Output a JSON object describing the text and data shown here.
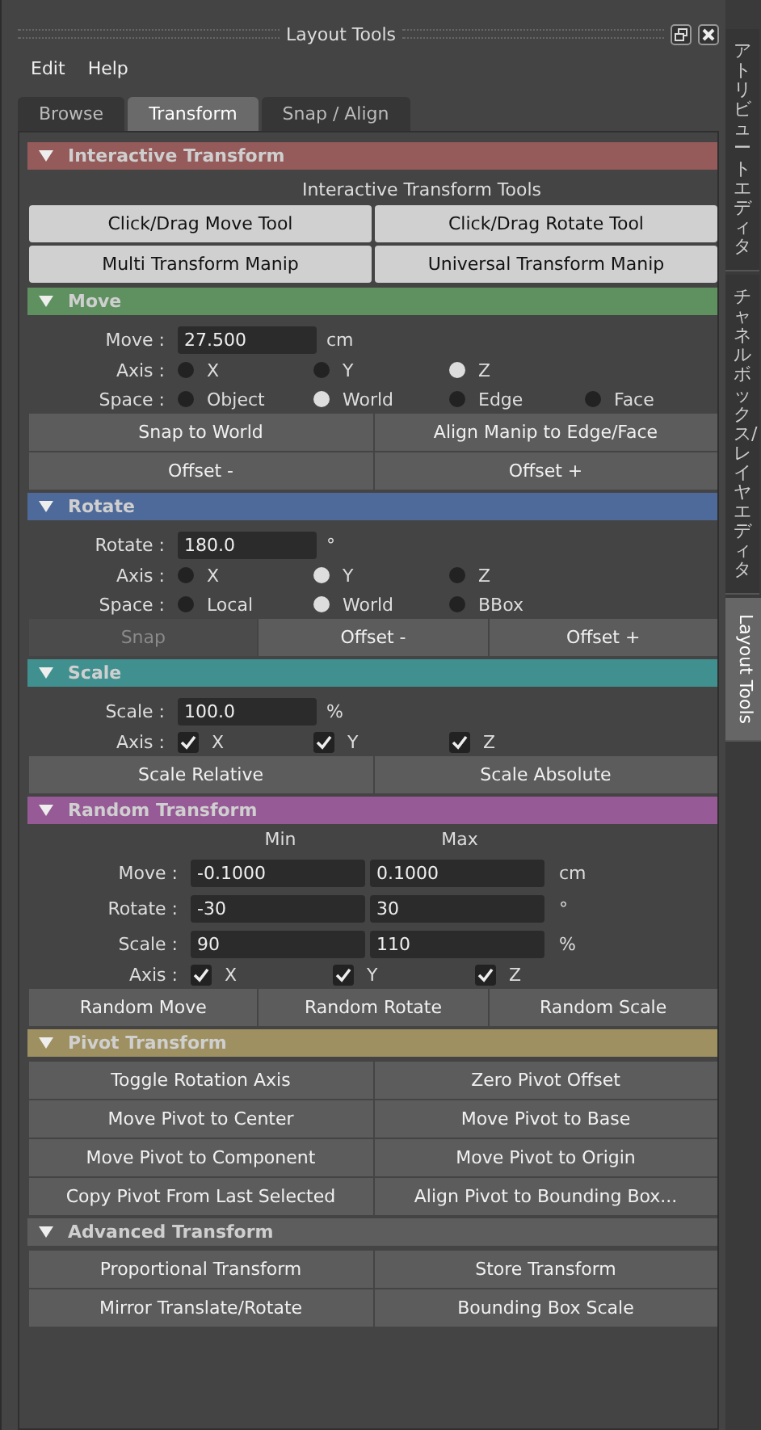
{
  "window": {
    "title": "Layout Tools"
  },
  "menu": [
    "Edit",
    "Help"
  ],
  "tabs": [
    {
      "label": "Browse",
      "selected": false
    },
    {
      "label": "Transform",
      "selected": true
    },
    {
      "label": "Snap / Align",
      "selected": false
    }
  ],
  "sections": [
    {
      "title": "Interactive Transform",
      "color": "#955a5a",
      "expanded": true,
      "rows": [
        {
          "kind": "caption",
          "text": "Interactive Transform Tools"
        },
        {
          "kind": "light_buttons",
          "buttons": [
            {
              "label": "Click/Drag Move Tool",
              "disabled": false
            },
            {
              "label": "Click/Drag Rotate Tool",
              "disabled": false
            }
          ]
        },
        {
          "kind": "light_buttons",
          "buttons": [
            {
              "label": "Multi Transform Manip",
              "disabled": false
            },
            {
              "label": "Universal Transform Manip",
              "disabled": false
            }
          ]
        }
      ]
    },
    {
      "title": "Move",
      "color": "#5f9160",
      "expanded": true,
      "rows": [
        {
          "kind": "field",
          "label": "Move :",
          "value": "27.500",
          "unit": "cm"
        },
        {
          "kind": "radio",
          "label": "Axis :",
          "options": [
            {
              "label": "X",
              "selected": false
            },
            {
              "label": "Y",
              "selected": false
            },
            {
              "label": "Z",
              "selected": true
            }
          ]
        },
        {
          "kind": "radio",
          "label": "Space :",
          "options": [
            {
              "label": "Object",
              "selected": false
            },
            {
              "label": "World",
              "selected": true
            },
            {
              "label": "Edge",
              "selected": false
            },
            {
              "label": "Face",
              "selected": false
            }
          ]
        },
        {
          "kind": "buttons",
          "buttons": [
            {
              "label": "Snap to World",
              "disabled": false
            },
            {
              "label": "Align Manip to Edge/Face",
              "disabled": false
            }
          ]
        },
        {
          "kind": "buttons",
          "buttons": [
            {
              "label": "Offset -",
              "disabled": false
            },
            {
              "label": "Offset +",
              "disabled": false
            }
          ]
        }
      ]
    },
    {
      "title": "Rotate",
      "color": "#4e6a9a",
      "expanded": true,
      "rows": [
        {
          "kind": "field",
          "label": "Rotate :",
          "value": "180.0",
          "unit": "°"
        },
        {
          "kind": "radio",
          "label": "Axis :",
          "options": [
            {
              "label": "X",
              "selected": false
            },
            {
              "label": "Y",
              "selected": true
            },
            {
              "label": "Z",
              "selected": false
            }
          ]
        },
        {
          "kind": "radio",
          "label": "Space :",
          "options": [
            {
              "label": "Local",
              "selected": false
            },
            {
              "label": "World",
              "selected": true
            },
            {
              "label": "BBox",
              "selected": false
            }
          ]
        },
        {
          "kind": "buttons",
          "buttons": [
            {
              "label": "Snap",
              "disabled": true
            },
            {
              "label": "Offset -",
              "disabled": false
            },
            {
              "label": "Offset +",
              "disabled": false
            }
          ]
        }
      ]
    },
    {
      "title": "Scale",
      "color": "#419090",
      "expanded": true,
      "rows": [
        {
          "kind": "field",
          "label": "Scale :",
          "value": "100.0",
          "unit": "%"
        },
        {
          "kind": "check",
          "label": "Axis :",
          "options": [
            {
              "label": "X",
              "checked": true
            },
            {
              "label": "Y",
              "checked": true
            },
            {
              "label": "Z",
              "checked": true
            }
          ]
        },
        {
          "kind": "buttons",
          "buttons": [
            {
              "label": "Scale Relative",
              "disabled": false
            },
            {
              "label": "Scale Absolute",
              "disabled": false
            }
          ]
        }
      ]
    },
    {
      "title": "Random Transform",
      "color": "#965a96",
      "expanded": true,
      "rows": [
        {
          "kind": "header",
          "columns": [
            "Min",
            "Max"
          ]
        },
        {
          "kind": "range",
          "label": "Move :",
          "min": "-0.1000",
          "max": "0.1000",
          "unit": "cm"
        },
        {
          "kind": "range",
          "label": "Rotate :",
          "min": "-30",
          "max": "30",
          "unit": "°"
        },
        {
          "kind": "range",
          "label": "Scale :",
          "min": "90",
          "max": "110",
          "unit": "%"
        },
        {
          "kind": "check",
          "label": "Axis :",
          "options": [
            {
              "label": "X",
              "checked": true
            },
            {
              "label": "Y",
              "checked": true
            },
            {
              "label": "Z",
              "checked": true
            }
          ]
        },
        {
          "kind": "buttons",
          "buttons": [
            {
              "label": "Random Move",
              "disabled": false
            },
            {
              "label": "Random Rotate",
              "disabled": false
            },
            {
              "label": "Random Scale",
              "disabled": false
            }
          ]
        }
      ]
    },
    {
      "title": "Pivot Transform",
      "color": "#9e9060",
      "expanded": true,
      "rows": [
        {
          "kind": "buttons",
          "buttons": [
            {
              "label": "Toggle Rotation Axis",
              "disabled": false
            },
            {
              "label": "Zero Pivot Offset",
              "disabled": false
            }
          ]
        },
        {
          "kind": "buttons",
          "buttons": [
            {
              "label": "Move Pivot to Center",
              "disabled": false
            },
            {
              "label": "Move Pivot to Base",
              "disabled": false
            }
          ]
        },
        {
          "kind": "buttons",
          "buttons": [
            {
              "label": "Move Pivot to Component",
              "disabled": false
            },
            {
              "label": "Move Pivot to Origin",
              "disabled": false
            }
          ]
        },
        {
          "kind": "buttons",
          "buttons": [
            {
              "label": "Copy Pivot From Last Selected",
              "disabled": false
            },
            {
              "label": "Align Pivot to Bounding Box...",
              "disabled": false
            }
          ]
        }
      ]
    },
    {
      "title": "Advanced Transform",
      "color": "#5d5d5d",
      "expanded": true,
      "rows": [
        {
          "kind": "buttons",
          "buttons": [
            {
              "label": "Proportional Transform",
              "disabled": false
            },
            {
              "label": "Store Transform",
              "disabled": false
            }
          ]
        },
        {
          "kind": "buttons",
          "buttons": [
            {
              "label": "Mirror Translate/Rotate",
              "disabled": false
            },
            {
              "label": "Bounding Box Scale",
              "disabled": false
            }
          ]
        }
      ]
    }
  ],
  "side_tabs": [
    {
      "label": "アトリビュートエディタ",
      "kind": "cjk",
      "selected": false
    },
    {
      "label": "チャネルボックス/レイヤエディタ",
      "kind": "cjk",
      "selected": false
    },
    {
      "label": "Layout Tools",
      "kind": "latin",
      "selected": true
    }
  ]
}
